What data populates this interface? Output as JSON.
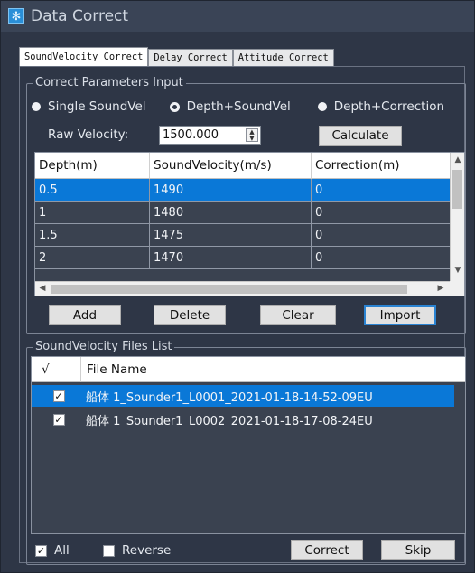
{
  "window": {
    "title": "Data Correct",
    "icon": "snowflake-icon",
    "accent_color": "#0a78d7",
    "background_color": "#2e3646"
  },
  "tabs": [
    {
      "label": "SoundVelocity Correct",
      "active": true
    },
    {
      "label": "Delay Correct",
      "active": false
    },
    {
      "label": "Attitude Correct",
      "active": false
    }
  ],
  "params": {
    "group_title": "Correct Parameters Input",
    "radio_options": [
      {
        "label": "Single SoundVel",
        "checked": false
      },
      {
        "label": "Depth+SoundVel",
        "checked": true
      },
      {
        "label": "Depth+Correction",
        "checked": false
      }
    ],
    "raw_velocity_label": "Raw Velocity:",
    "raw_velocity_value": "1500.000",
    "calculate_label": "Calculate"
  },
  "table": {
    "columns": [
      "Depth(m)",
      "SoundVelocity(m/s)",
      "Correction(m)"
    ],
    "rows": [
      {
        "depth": "0.5",
        "velocity": "1490",
        "correction": "0",
        "selected": true
      },
      {
        "depth": "1",
        "velocity": "1480",
        "correction": "0",
        "selected": false
      },
      {
        "depth": "1.5",
        "velocity": "1475",
        "correction": "0",
        "selected": false
      },
      {
        "depth": "2",
        "velocity": "1470",
        "correction": "0",
        "selected": false
      }
    ]
  },
  "table_buttons": {
    "add": "Add",
    "delete": "Delete",
    "clear": "Clear",
    "import": "Import"
  },
  "files": {
    "group_title": "SoundVelocity Files List",
    "columns": [
      "√",
      "File Name"
    ],
    "rows": [
      {
        "checked": true,
        "name": "船体 1_Sounder1_L0001_2021-01-18-14-52-09EU",
        "selected": true
      },
      {
        "checked": true,
        "name": "船体 1_Sounder1_L0002_2021-01-18-17-08-24EU",
        "selected": false
      }
    ]
  },
  "footer": {
    "all_label": "All",
    "all_checked": true,
    "reverse_label": "Reverse",
    "reverse_checked": false,
    "correct_label": "Correct",
    "skip_label": "Skip"
  }
}
